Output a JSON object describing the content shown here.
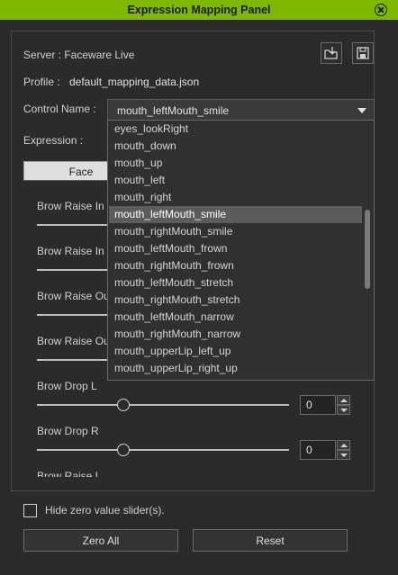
{
  "window": {
    "title": "Expression Mapping Panel"
  },
  "server": {
    "label": "Server : Faceware Live"
  },
  "profile": {
    "label": "Profile :",
    "value": "default_mapping_data.json"
  },
  "control_name": {
    "label": "Control Name :",
    "selected": "mouth_leftMouth_smile"
  },
  "expression": {
    "label": "Expression :"
  },
  "tabs": [
    {
      "label": "Face"
    }
  ],
  "dropdown": {
    "options": [
      "eyes_lookRight",
      "mouth_down",
      "mouth_up",
      "mouth_left",
      "mouth_right",
      "mouth_leftMouth_smile",
      "mouth_rightMouth_smile",
      "mouth_leftMouth_frown",
      "mouth_rightMouth_frown",
      "mouth_leftMouth_stretch",
      "mouth_rightMouth_stretch",
      "mouth_leftMouth_narrow",
      "mouth_rightMouth_narrow",
      "mouth_upperLip_left_up",
      "mouth_upperLip_right_up"
    ],
    "selected_index": 5
  },
  "sliders": [
    {
      "name": "Brow Raise In"
    },
    {
      "name": "Brow Raise In"
    },
    {
      "name": "Brow Raise Ou"
    },
    {
      "name": "Brow Raise Ou"
    },
    {
      "name": "Brow Drop L",
      "value": "0"
    },
    {
      "name": "Brow Drop R",
      "value": "0"
    },
    {
      "name": "Brow Raise L"
    }
  ],
  "hide_zero": {
    "label": "Hide zero value slider(s).",
    "checked": false
  },
  "buttons": {
    "zero_all": "Zero All",
    "reset": "Reset"
  },
  "icons": {
    "close": "close-icon",
    "import": "import-folder-icon",
    "save": "save-icon"
  },
  "colors": {
    "titlebar": "#7fb800",
    "selection": "#5c5c5c"
  }
}
